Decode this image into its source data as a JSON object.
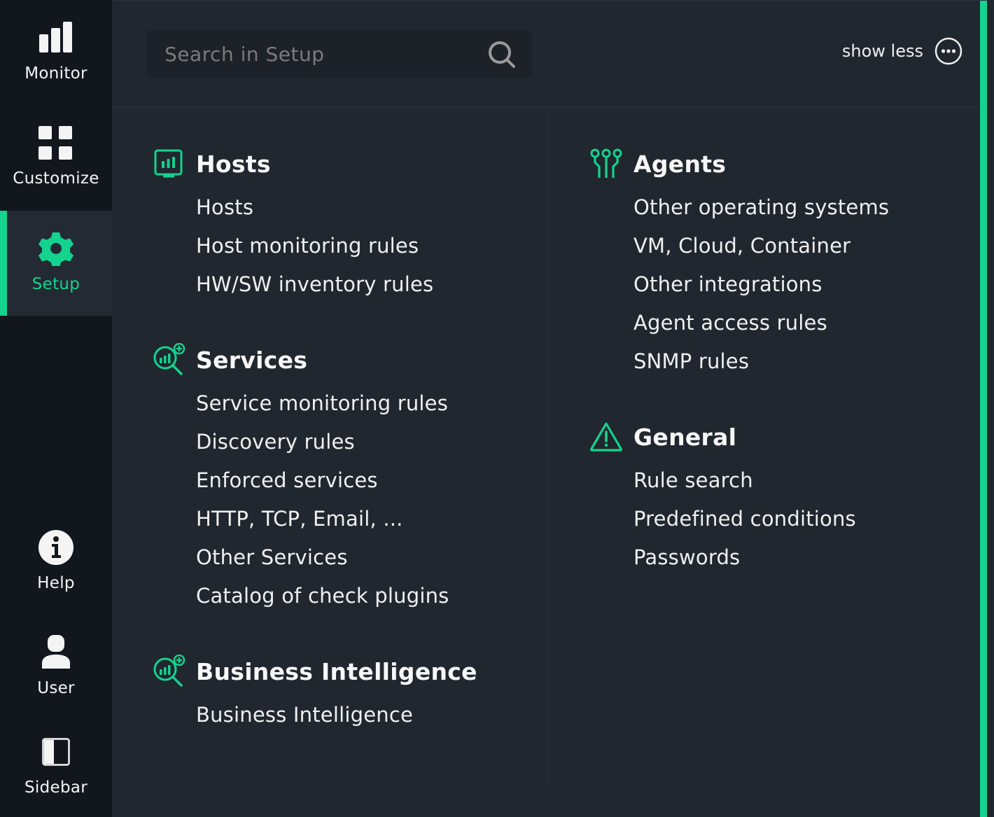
{
  "nav": {
    "items": [
      {
        "label": "Monitor",
        "icon": "bar-chart-icon",
        "active": false
      },
      {
        "label": "Customize",
        "icon": "grid-icon",
        "active": false
      },
      {
        "label": "Setup",
        "icon": "gear-icon",
        "active": true
      },
      {
        "label": "Help",
        "icon": "info-icon",
        "active": false
      },
      {
        "label": "User",
        "icon": "user-icon",
        "active": false
      },
      {
        "label": "Sidebar",
        "icon": "sidebar-toggle-icon",
        "active": false
      }
    ]
  },
  "search": {
    "placeholder": "Search in Setup",
    "value": ""
  },
  "header": {
    "show_less_label": "show less"
  },
  "colors": {
    "accent": "#13d38e",
    "nav_bg": "#12171e",
    "main_bg": "#21272f",
    "search_bg": "#1d2128"
  },
  "sections": {
    "hosts": {
      "title": "Hosts",
      "icon": "host-monitor-icon",
      "items": [
        "Hosts",
        "Host monitoring rules",
        "HW/SW inventory rules"
      ]
    },
    "services": {
      "title": "Services",
      "icon": "service-search-icon",
      "items": [
        "Service monitoring rules",
        "Discovery rules",
        "Enforced services",
        "HTTP, TCP, Email, ...",
        "Other Services",
        "Catalog of check plugins"
      ]
    },
    "bi": {
      "title": "Business Intelligence",
      "icon": "bi-search-icon",
      "items": [
        "Business Intelligence"
      ]
    },
    "agents": {
      "title": "Agents",
      "icon": "agents-icon",
      "items": [
        "Other operating systems",
        "VM, Cloud, Container",
        "Other integrations",
        "Agent access rules",
        "SNMP rules"
      ]
    },
    "general": {
      "title": "General",
      "icon": "warning-triangle-icon",
      "items": [
        "Rule search",
        "Predefined conditions",
        "Passwords"
      ]
    }
  }
}
